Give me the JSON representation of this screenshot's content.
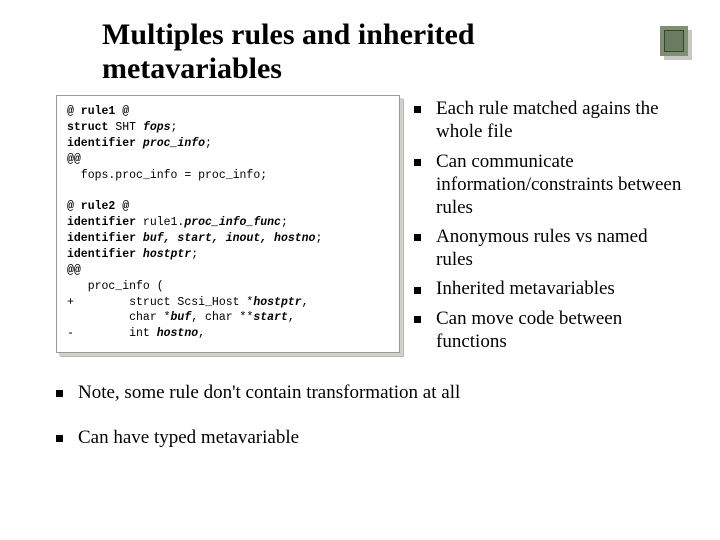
{
  "title": "Multiples rules and inherited metavariables",
  "code": {
    "l1a": "@ rule1 @",
    "l1b": "struct",
    "l1c": " SHT ",
    "l1d": "fops",
    "l1e": ";",
    "l2a": "identifier",
    "l2b": " ",
    "l2c": "proc_info",
    "l2d": ";",
    "l3": "@@",
    "l4": "  fops.proc_info = proc_info;",
    "gap": "",
    "l5": "@ rule2 @",
    "l6a": "identifier",
    "l6b": " rule1.",
    "l6c": "proc_info_func",
    "l6d": ";",
    "l7a": "identifier",
    "l7b": " ",
    "l7c": "buf, start, inout, hostno",
    "l7d": ";",
    "l8a": "identifier",
    "l8b": " ",
    "l8c": "hostptr",
    "l8d": ";",
    "l9": "@@",
    "l10": "   proc_info (",
    "l11a": "+        struct Scsi_Host *",
    "l11b": "hostptr",
    "l11c": ",",
    "l12a": "         char *",
    "l12b": "buf",
    "l12c": ", char **",
    "l12d": "start",
    "l12e": ",",
    "l13a": "-        int ",
    "l13b": "hostno",
    "l13c": ","
  },
  "right_bullets": [
    "Each rule matched agains the whole file",
    "Can communicate information/constraints between rules",
    "Anonymous rules vs named rules",
    "Inherited metavariables",
    "Can move code between functions"
  ],
  "lower_bullets": [
    "Note, some rule don't contain transformation at all",
    "Can have typed metavariable"
  ]
}
